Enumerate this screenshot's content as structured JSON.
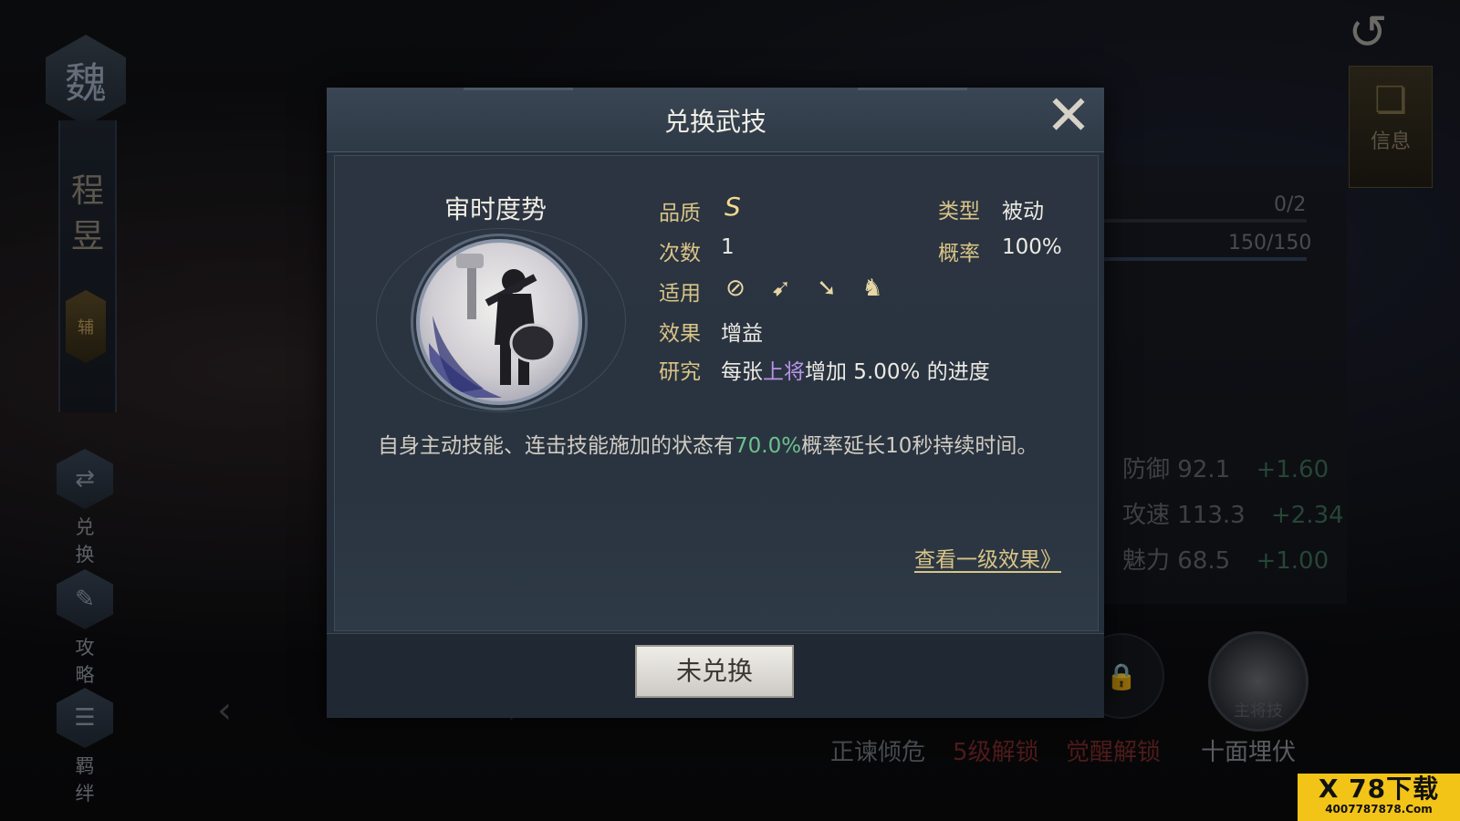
{
  "background": {
    "faction_char": "魏",
    "general_name": [
      "程",
      "昱"
    ],
    "role_badge": "辅",
    "side_buttons": [
      {
        "label": "兑 换",
        "icon": "exchange-icon"
      },
      {
        "label": "攻 略",
        "icon": "scroll-icon"
      },
      {
        "label": "羁 绊",
        "icon": "bond-icon"
      }
    ],
    "info_tab_label": "信息",
    "progress_1": "0/2",
    "progress_2": "150/150",
    "stats": [
      {
        "name": "防御",
        "value": "92.1",
        "gain": "+1.60"
      },
      {
        "name": "攻速",
        "value": "113.3",
        "gain": "+2.34"
      },
      {
        "name": "魅力",
        "value": "68.5",
        "gain": "+1.00"
      }
    ],
    "bottom_skills": [
      {
        "label": "正谏倾危",
        "color": "#6f737a"
      },
      {
        "label": "5级解锁",
        "color": "#7a2a2a"
      },
      {
        "label": "觉醒解锁",
        "color": "#7a2a2a"
      },
      {
        "label": "十面埋伏",
        "color": "#8a8d93"
      }
    ],
    "main_skill_tag": "主将技"
  },
  "dialog": {
    "title": "兑换武技",
    "skill_name": "审时度势",
    "quality_label": "品质",
    "quality_value": "S",
    "type_label": "类型",
    "type_value": "被动",
    "count_label": "次数",
    "count_value": "1",
    "rate_label": "概率",
    "rate_value": "100%",
    "apply_label": "适用",
    "apply_icons": [
      "shield-icon",
      "bow-icon",
      "spear-icon",
      "horse-icon"
    ],
    "effect_label": "效果",
    "effect_value": "增益",
    "research_label": "研究",
    "research_prefix": "每张",
    "research_highlight": "上将",
    "research_suffix": "增加 5.00% 的进度",
    "desc_prefix": "自身主动技能、连击技能施加的状态有",
    "desc_highlight": "70.0%",
    "desc_suffix": "概率延长10秒持续时间。",
    "view_link": "查看一级效果》",
    "exchange_button": "未兑换"
  },
  "watermark": {
    "big": "X 78下载",
    "small": "4007787878.Com"
  },
  "colors": {
    "gold_label": "#d9c487",
    "purple_highlight": "#b892e8",
    "green_highlight": "#6cc08f",
    "dialog_bg": "#26303c"
  }
}
